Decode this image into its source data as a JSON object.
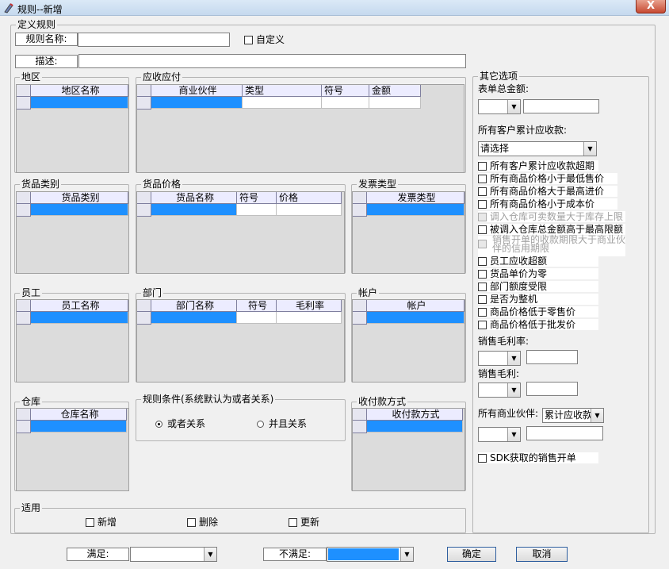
{
  "window": {
    "title": "规则--新增",
    "close": "X"
  },
  "rule_def": {
    "legend": "定义规则",
    "name_label": "规则名称:",
    "name_value": "",
    "custom_label": "自定义",
    "desc_label": "描述:",
    "desc_value": ""
  },
  "region": {
    "legend": "地区",
    "col": "地区名称"
  },
  "ar": {
    "legend": "应收应付",
    "cols": [
      "商业伙伴",
      "类型",
      "符号",
      "金额"
    ]
  },
  "goods_cat": {
    "legend": "货品类别",
    "col": "货品类别"
  },
  "goods_price": {
    "legend": "货品价格",
    "cols": [
      "货品名称",
      "符号",
      "价格"
    ]
  },
  "invoice": {
    "legend": "发票类型",
    "col": "发票类型"
  },
  "staff": {
    "legend": "员工",
    "col": "员工名称"
  },
  "dept": {
    "legend": "部门",
    "cols": [
      "部门名称",
      "符号",
      "毛利率"
    ]
  },
  "account": {
    "legend": "帐户",
    "col": "帐户"
  },
  "warehouse": {
    "legend": "仓库",
    "col": "仓库名称"
  },
  "rule_cond": {
    "legend": "规则条件(系统默认为或者关系)",
    "or_label": "或者关系",
    "and_label": "并且关系"
  },
  "payment": {
    "legend": "收付款方式",
    "col": "收付款方式"
  },
  "apply": {
    "legend": "适用",
    "add": "新增",
    "delete": "删除",
    "update": "更新"
  },
  "other": {
    "legend": "其它选项",
    "total_label": "表单总金额:",
    "all_ar_label": "所有客户累计应收款:",
    "all_ar_select": "请选择",
    "checks": [
      "所有客户累计应收款超期",
      "所有商品价格小于最低售价",
      "所有商品价格大于最高进价",
      "所有商品价格小于成本价",
      "调入仓库可卖数量大于库存上限",
      "被调入仓库总金额高于最高限额",
      "销售开单的收款期限大于商业伙伴的信用期限",
      "员工应收超额",
      "货品单价为零",
      "部门额度受限",
      "是否为整机",
      "商品价格低于零售价",
      "商品价格低于批发价"
    ],
    "margin_rate_label": "销售毛利率:",
    "margin_label": "销售毛利:",
    "partner_label": "所有商业伙伴:",
    "partner_select": "累计应收款",
    "sdk_label": "SDK获取的销售开单"
  },
  "footer": {
    "satisfy_label": "满足:",
    "satisfy_value": "",
    "unsatisfy_label": "不满足:",
    "ok": "确定",
    "cancel": "取消"
  }
}
